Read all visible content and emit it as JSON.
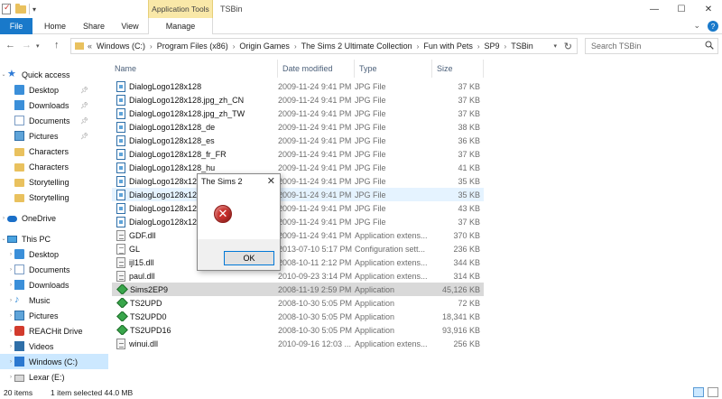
{
  "window": {
    "contextual_tab": "Application Tools",
    "title": "TSBin",
    "minimize": "—",
    "maximize": "☐",
    "close": "✕"
  },
  "ribbon": {
    "tabs": [
      "File",
      "Home",
      "Share",
      "View",
      "Manage"
    ]
  },
  "address": {
    "overflow": "«",
    "crumbs": [
      "Windows (C:)",
      "Program Files (x86)",
      "Origin Games",
      "The Sims 2 Ultimate Collection",
      "Fun with Pets",
      "SP9",
      "TSBin"
    ],
    "separator": "›"
  },
  "search": {
    "placeholder": "Search TSBin"
  },
  "sidebar": {
    "items": [
      {
        "label": "Quick access",
        "icon": "star-icon",
        "pinned": false
      },
      {
        "label": "Desktop",
        "icon": "desktop-icon",
        "pinned": true
      },
      {
        "label": "Downloads",
        "icon": "downloads-icon",
        "pinned": true
      },
      {
        "label": "Documents",
        "icon": "documents-icon",
        "pinned": true
      },
      {
        "label": "Pictures",
        "icon": "pictures-icon",
        "pinned": true
      },
      {
        "label": "Characters",
        "icon": "folder-icon",
        "pinned": false
      },
      {
        "label": "Characters",
        "icon": "folder-icon",
        "pinned": false
      },
      {
        "label": "Storytelling",
        "icon": "folder-icon",
        "pinned": false
      },
      {
        "label": "Storytelling",
        "icon": "folder-icon",
        "pinned": false
      },
      {
        "label": "OneDrive",
        "icon": "onedrive-icon",
        "pinned": false
      },
      {
        "label": "This PC",
        "icon": "this-pc-icon",
        "pinned": false
      },
      {
        "label": "Desktop",
        "icon": "desktop-icon",
        "pinned": false
      },
      {
        "label": "Documents",
        "icon": "documents-icon",
        "pinned": false
      },
      {
        "label": "Downloads",
        "icon": "downloads-icon",
        "pinned": false
      },
      {
        "label": "Music",
        "icon": "music-icon",
        "pinned": false
      },
      {
        "label": "Pictures",
        "icon": "pictures-icon",
        "pinned": false
      },
      {
        "label": "REACHit Drive",
        "icon": "reachit-drive-icon",
        "pinned": false
      },
      {
        "label": "Videos",
        "icon": "videos-icon",
        "pinned": false
      },
      {
        "label": "Windows (C:)",
        "icon": "windows-drive-icon",
        "pinned": false
      },
      {
        "label": "Lexar (E:)",
        "icon": "usb-drive-icon",
        "pinned": false
      }
    ]
  },
  "columns": {
    "name": "Name",
    "date": "Date modified",
    "type": "Type",
    "size": "Size"
  },
  "files": [
    {
      "name": "DialogLogo128x128",
      "date": "2009-11-24 9:41 PM",
      "type": "JPG File",
      "size": "37 KB",
      "icon": "jpg-file-icon"
    },
    {
      "name": "DialogLogo128x128.jpg_zh_CN",
      "date": "2009-11-24 9:41 PM",
      "type": "JPG File",
      "size": "37 KB",
      "icon": "jpg-file-icon"
    },
    {
      "name": "DialogLogo128x128.jpg_zh_TW",
      "date": "2009-11-24 9:41 PM",
      "type": "JPG File",
      "size": "37 KB",
      "icon": "jpg-file-icon"
    },
    {
      "name": "DialogLogo128x128_de",
      "date": "2009-11-24 9:41 PM",
      "type": "JPG File",
      "size": "38 KB",
      "icon": "jpg-file-icon"
    },
    {
      "name": "DialogLogo128x128_es",
      "date": "2009-11-24 9:41 PM",
      "type": "JPG File",
      "size": "36 KB",
      "icon": "jpg-file-icon"
    },
    {
      "name": "DialogLogo128x128_fr_FR",
      "date": "2009-11-24 9:41 PM",
      "type": "JPG File",
      "size": "37 KB",
      "icon": "jpg-file-icon"
    },
    {
      "name": "DialogLogo128x128_hu",
      "date": "2009-11-24 9:41 PM",
      "type": "JPG File",
      "size": "41 KB",
      "icon": "jpg-file-icon"
    },
    {
      "name": "DialogLogo128x128_",
      "date": "2009-11-24 9:41 PM",
      "type": "JPG File",
      "size": "35 KB",
      "icon": "jpg-file-icon"
    },
    {
      "name": "DialogLogo128x128_",
      "date": "2009-11-24 9:41 PM",
      "type": "JPG File",
      "size": "35 KB",
      "icon": "jpg-file-icon"
    },
    {
      "name": "DialogLogo128x128_",
      "date": "2009-11-24 9:41 PM",
      "type": "JPG File",
      "size": "43 KB",
      "icon": "jpg-file-icon"
    },
    {
      "name": "DialogLogo128x128_",
      "date": "2009-11-24 9:41 PM",
      "type": "JPG File",
      "size": "37 KB",
      "icon": "jpg-file-icon"
    },
    {
      "name": "GDF.dll",
      "date": "2009-11-24 9:41 PM",
      "type": "Application extens...",
      "size": "370 KB",
      "icon": "dll-file-icon"
    },
    {
      "name": "GL",
      "date": "2013-07-10 5:17 PM",
      "type": "Configuration sett...",
      "size": "236 KB",
      "icon": "config-file-icon"
    },
    {
      "name": "ijl15.dll",
      "date": "2008-10-11 2:12 PM",
      "type": "Application extens...",
      "size": "344 KB",
      "icon": "dll-file-icon"
    },
    {
      "name": "paul.dll",
      "date": "2010-09-23 3:14 PM",
      "type": "Application extens...",
      "size": "314 KB",
      "icon": "dll-file-icon"
    },
    {
      "name": "Sims2EP9",
      "date": "2008-11-19 2:59 PM",
      "type": "Application",
      "size": "45,126 KB",
      "icon": "sims-app-icon"
    },
    {
      "name": "TS2UPD",
      "date": "2008-10-30 5:05 PM",
      "type": "Application",
      "size": "72 KB",
      "icon": "sims-app-icon"
    },
    {
      "name": "TS2UPD0",
      "date": "2008-10-30 5:05 PM",
      "type": "Application",
      "size": "18,341 KB",
      "icon": "sims-app-icon"
    },
    {
      "name": "TS2UPD16",
      "date": "2008-10-30 5:05 PM",
      "type": "Application",
      "size": "93,916 KB",
      "icon": "sims-app-icon"
    },
    {
      "name": "winui.dll",
      "date": "2010-09-16 12:03 ...",
      "type": "Application extens...",
      "size": "256 KB",
      "icon": "dll-file-icon"
    }
  ],
  "selected_index": 15,
  "hover_index": 8,
  "status": {
    "items": "20 items",
    "selected": "1 item selected  44.0 MB"
  },
  "dialog": {
    "title": "The Sims 2",
    "close": "✕",
    "icon": "error-icon",
    "error_glyph": "✕",
    "ok_label": "OK"
  },
  "colors": {
    "accent": "#1979ca",
    "selection": "#d9d9d9",
    "contextual_tab": "#f9e8a8",
    "error": "#c9302c"
  }
}
